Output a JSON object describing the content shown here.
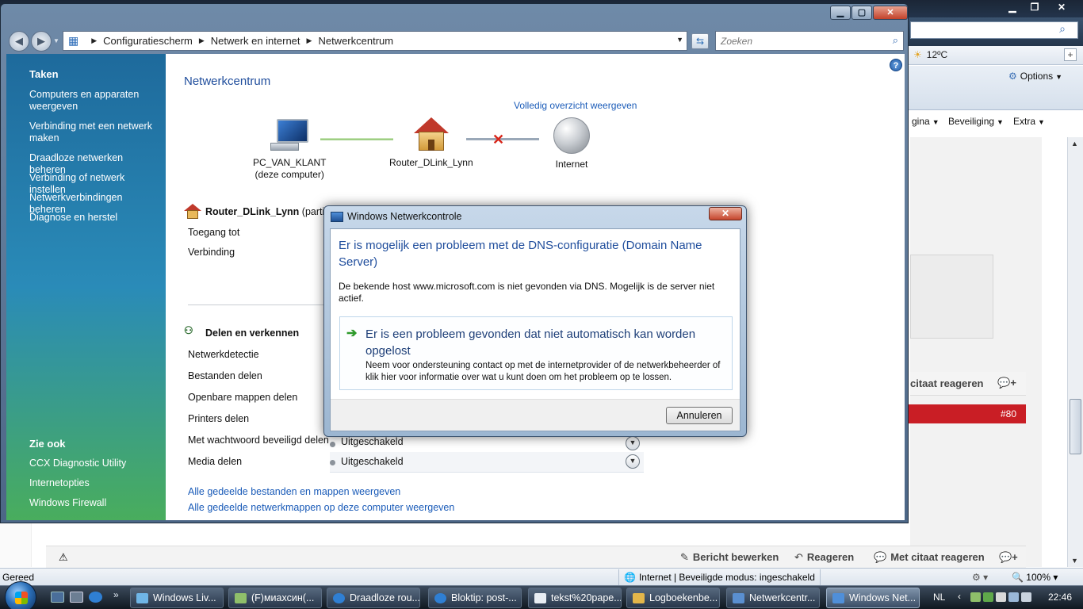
{
  "ie": {
    "search_icon": "search-icon",
    "weather": {
      "icon": "sun-cloud-icon",
      "temperature": "12ºC"
    },
    "command_bar": {
      "options_label": "Options",
      "page_label": "gina",
      "security_label": "Beveiliging",
      "extra_label": "Extra"
    },
    "page": {
      "reply_with_quote_top": "citaat reageren",
      "post_number": "#80"
    },
    "actions": {
      "edit_post": "Bericht bewerken",
      "reply": "Reageren",
      "reply_with_quote": "Met citaat reageren"
    },
    "status": {
      "ready": "Gereed",
      "zone": "Internet | Beveiligde modus: ingeschakeld",
      "zoom": "100%"
    }
  },
  "network_center": {
    "breadcrumb": [
      "Configuratiescherm",
      "Netwerk en internet",
      "Netwerkcentrum"
    ],
    "search_placeholder": "Zoeken",
    "sidebar": {
      "tasks_heading": "Taken",
      "tasks": [
        "Computers en apparaten weergeven",
        "Verbinding met een netwerk maken",
        "Draadloze netwerken beheren",
        "Verbinding of netwerk instellen",
        "Netwerkverbindingen beheren",
        "Diagnose en herstel"
      ],
      "see_also_heading": "Zie ook",
      "see_also": [
        "CCX Diagnostic Utility",
        "Internetopties",
        "Windows Firewall"
      ]
    },
    "heading": "Netwerkcentrum",
    "full_view_link": "Volledig overzicht weergeven",
    "map": {
      "computer_name": "PC_VAN_KLANT",
      "computer_sub": "(deze computer)",
      "router_name": "Router_DLink_Lynn",
      "internet_label": "Internet"
    },
    "network": {
      "name": "Router_DLink_Lynn",
      "type_suffix": "(particu",
      "access_label": "Toegang tot",
      "connection_label": "Verbinding"
    },
    "sharing": {
      "heading": "Delen en verkennen",
      "rows": [
        "Netwerkdetectie",
        "Bestanden delen",
        "Openbare mappen delen",
        "Printers delen",
        "Met wachtwoord beveiligd delen",
        "Media delen"
      ],
      "password_status": "Uitgeschakeld",
      "media_status": "Uitgeschakeld"
    },
    "links": [
      "Alle gedeelde bestanden en mappen weergeven",
      "Alle gedeelde netwerkmappen op deze computer weergeven"
    ]
  },
  "dialog": {
    "title": "Windows Netwerkcontrole",
    "heading": "Er is mogelijk een probleem met de DNS-configuratie (Domain Name Server)",
    "description": "De bekende host www.microsoft.com is niet gevonden via DNS. Mogelijk is de server niet actief.",
    "option_title": "Er is een probleem gevonden dat niet automatisch kan worden opgelost",
    "option_description": "Neem voor ondersteuning contact op met de internetprovider of de netwerkbeheerder of klik hier voor informatie over wat u kunt doen om het probleem op te lossen.",
    "cancel_label": "Annuleren"
  },
  "taskbar": {
    "buttons": [
      "Windows Liv...",
      "(F)миахсин(...",
      "Draadloze rou...",
      "Bloktip: post-...",
      "tekst%20pape...",
      "Logboekenbe...",
      "Netwerkcentr...",
      "Windows Net..."
    ],
    "language": "NL",
    "clock": "22:46"
  }
}
